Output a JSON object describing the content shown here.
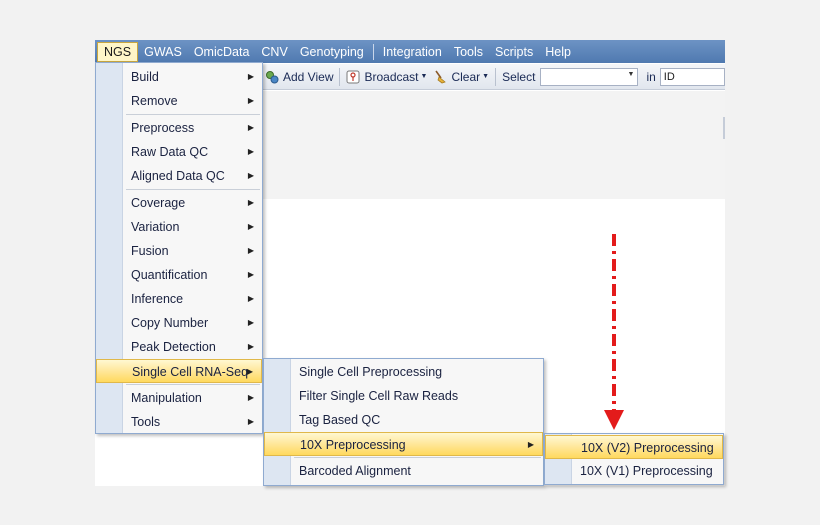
{
  "menubar": {
    "items": [
      "NGS",
      "GWAS",
      "OmicData",
      "CNV",
      "Genotyping",
      "Integration",
      "Tools",
      "Scripts",
      "Help"
    ]
  },
  "toolbar": {
    "add_view": "Add View",
    "broadcast": "Broadcast",
    "clear": "Clear",
    "select_label": "Select",
    "select_value": "",
    "in_label": "in",
    "id_field": "ID"
  },
  "ngs_menu": {
    "items": [
      "Build",
      "Remove",
      "Preprocess",
      "Raw Data QC",
      "Aligned Data QC",
      "Coverage",
      "Variation",
      "Fusion",
      "Quantification",
      "Inference",
      "Copy Number",
      "Peak Detection",
      "Single Cell RNA-Seq",
      "Manipulation",
      "Tools"
    ]
  },
  "scrnaseq_menu": {
    "items": [
      "Single Cell Preprocessing",
      "Filter Single Cell Raw Reads",
      "Tag Based QC",
      "10X Preprocessing",
      "Barcoded Alignment"
    ]
  },
  "tenx_menu": {
    "items": [
      "10X (V2) Preprocessing",
      "10X (V1) Preprocessing"
    ]
  },
  "colors": {
    "menubar": "#4f79b0",
    "highlight": "#ffe79a",
    "annotation_arrow": "#e31b1b"
  }
}
